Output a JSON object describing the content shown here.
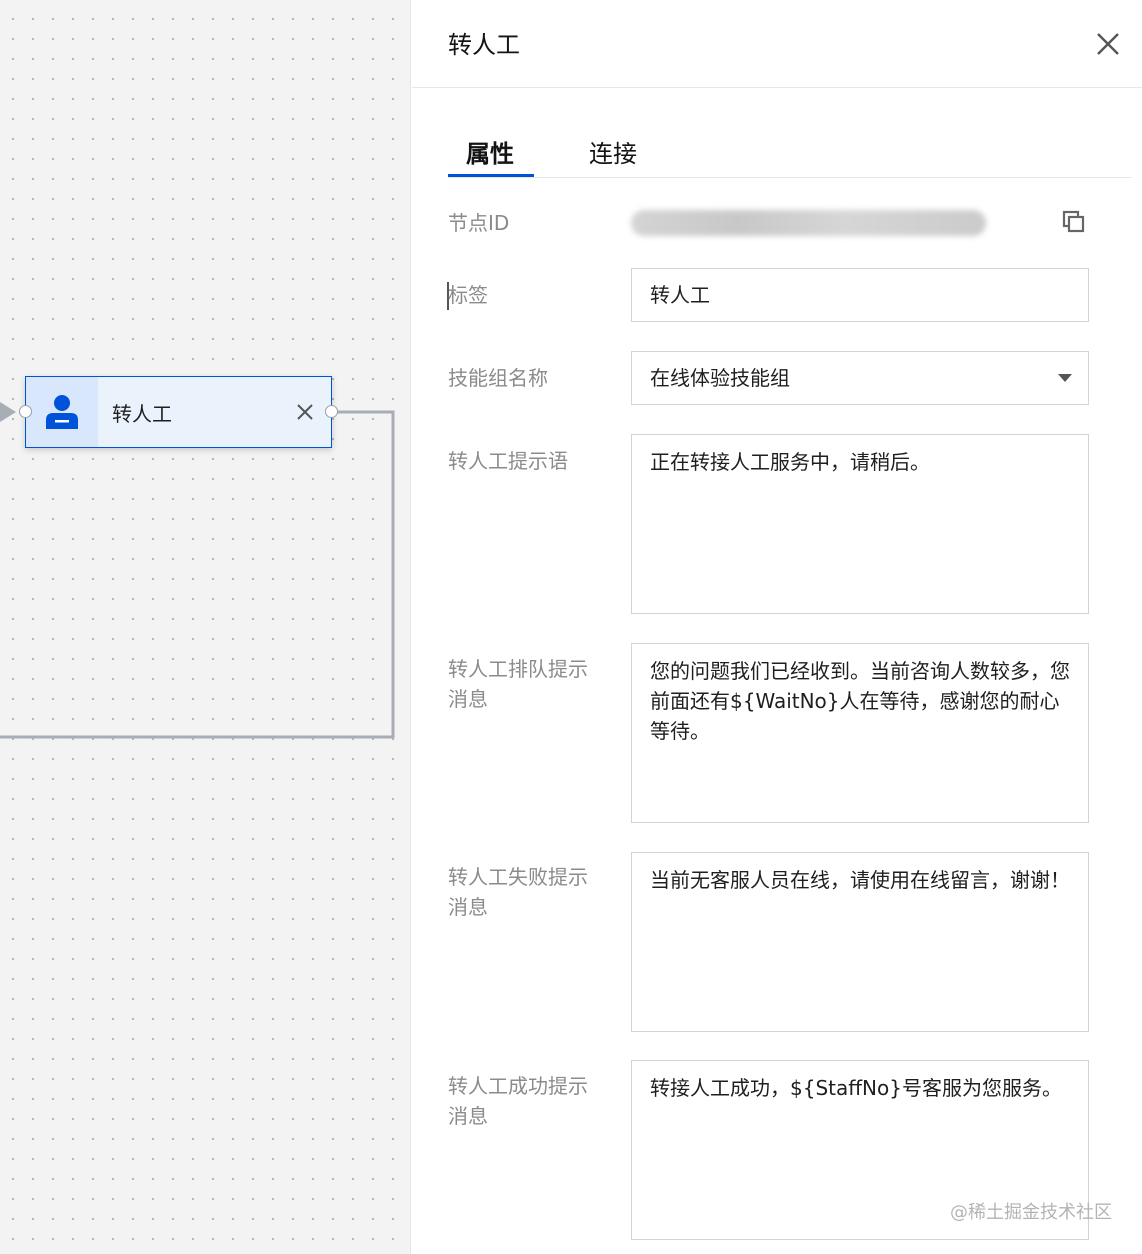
{
  "canvas": {
    "node": {
      "title": "转人工"
    }
  },
  "panel": {
    "title": "转人工",
    "tabs": [
      {
        "label": "属性"
      },
      {
        "label": "连接"
      }
    ],
    "fields": {
      "node_id": {
        "label": "节点ID"
      },
      "tag": {
        "label": "标签",
        "value": "转人工"
      },
      "skill_group": {
        "label": "技能组名称",
        "value": "在线体验技能组"
      },
      "prompt": {
        "label": "转人工提示语",
        "value": "正在转接人工服务中，请稍后。"
      },
      "queue_msg": {
        "label": "转人工排队提示消息",
        "value": "您的问题我们已经收到。当前咨询人数较多，您前面还有${WaitNo}人在等待，感谢您的耐心等待。"
      },
      "fail_msg": {
        "label": "转人工失败提示消息",
        "value": "当前无客服人员在线，请使用在线留言，谢谢！"
      },
      "success_msg": {
        "label": "转人工成功提示消息",
        "value": "转接人工成功，${StaffNo}号客服为您服务。"
      }
    },
    "watermark": "@稀土掘金技术社区"
  },
  "colors": {
    "accent": "#0052d9",
    "node_bg": "#eaf3fc",
    "label": "#8b8b8b"
  },
  "icons": {
    "node": "person-icon",
    "close": "close-icon",
    "copy": "copy-icon",
    "caret": "caret-down-icon"
  }
}
